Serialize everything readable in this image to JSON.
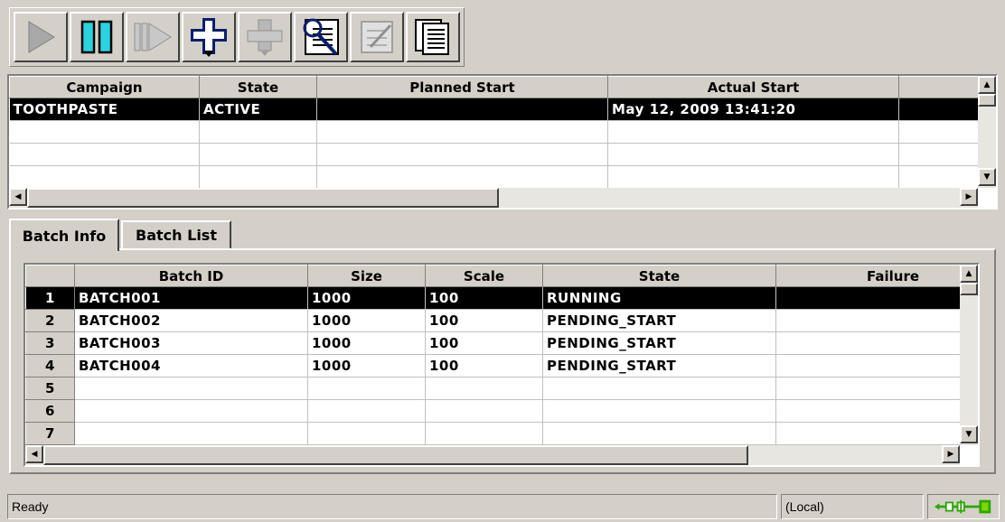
{
  "toolbar": {
    "buttons": [
      {
        "name": "play-button",
        "icon": "play-icon",
        "enabled": false
      },
      {
        "name": "pause-button",
        "icon": "pause-icon",
        "enabled": true
      },
      {
        "name": "step-button",
        "icon": "step-forward-icon",
        "enabled": false
      },
      {
        "name": "add-batch-button",
        "icon": "add-node-icon",
        "enabled": true
      },
      {
        "name": "remove-batch-button",
        "icon": "remove-node-icon",
        "enabled": false
      },
      {
        "name": "view-details-button",
        "icon": "magnifier-icon",
        "enabled": true
      },
      {
        "name": "edit-button",
        "icon": "edit-icon",
        "enabled": false
      },
      {
        "name": "report-button",
        "icon": "document-icon",
        "enabled": true
      }
    ]
  },
  "campaigns": {
    "columns": [
      "Campaign",
      "State",
      "Planned Start",
      "Actual Start"
    ],
    "rows": [
      {
        "campaign": "TOOTHPASTE",
        "state": "ACTIVE",
        "planned_start": "",
        "actual_start": "May 12, 2009 13:41:20",
        "selected": true
      }
    ]
  },
  "tabs": [
    {
      "label": "Batch Info",
      "active": true
    },
    {
      "label": "Batch List",
      "active": false
    }
  ],
  "batches": {
    "columns": [
      "Batch ID",
      "Size",
      "Scale",
      "State",
      "Failure"
    ],
    "rows": [
      {
        "num": "1",
        "batch_id": "BATCH001",
        "size": "1000",
        "scale": "100",
        "state": "RUNNING",
        "failure": "",
        "selected": true
      },
      {
        "num": "2",
        "batch_id": "BATCH002",
        "size": "1000",
        "scale": "100",
        "state": "PENDING_START",
        "failure": ""
      },
      {
        "num": "3",
        "batch_id": "BATCH003",
        "size": "1000",
        "scale": "100",
        "state": "PENDING_START",
        "failure": ""
      },
      {
        "num": "4",
        "batch_id": "BATCH004",
        "size": "1000",
        "scale": "100",
        "state": "PENDING_START",
        "failure": ""
      },
      {
        "num": "5",
        "batch_id": "",
        "size": "",
        "scale": "",
        "state": "",
        "failure": ""
      },
      {
        "num": "6",
        "batch_id": "",
        "size": "",
        "scale": "",
        "state": "",
        "failure": ""
      },
      {
        "num": "7",
        "batch_id": "",
        "size": "",
        "scale": "",
        "state": "",
        "failure": ""
      }
    ]
  },
  "status": {
    "message": "Ready",
    "location": "(Local)",
    "connection_icon": "network-connection-icon"
  },
  "colors": {
    "face": "#d4d0c8",
    "selection": "#000000",
    "accent_cyan": "#29d4e0",
    "accent_navy": "#0a1e6e",
    "connection_green": "#2aa800"
  }
}
